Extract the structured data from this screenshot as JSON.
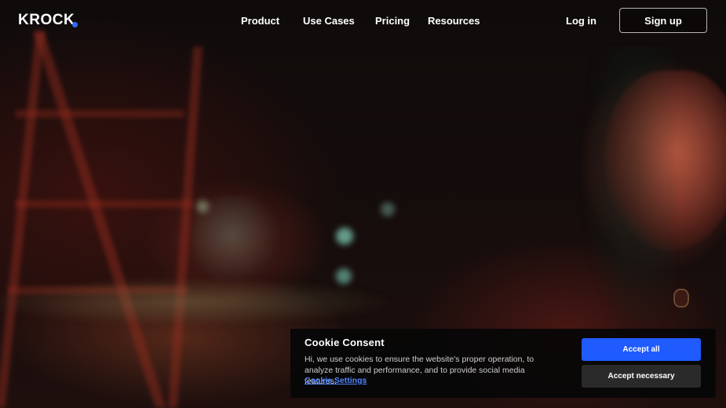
{
  "nav": {
    "logo": "KROCK",
    "links": [
      "Product",
      "Use Cases",
      "Pricing",
      "Resources"
    ],
    "login": "Log in",
    "signup": "Sign up",
    "accent_color": "#2e6bff"
  },
  "cookie": {
    "title": "Cookie Consent",
    "text": "Hi, we use cookies to ensure the website's proper operation, to analyze traffic and performance, and to provide social media features.",
    "settings_link": "Cookie Settings",
    "accept_all": "Accept all",
    "accept_necessary": "Accept necessary",
    "accept_all_color": "#1f5bff"
  }
}
